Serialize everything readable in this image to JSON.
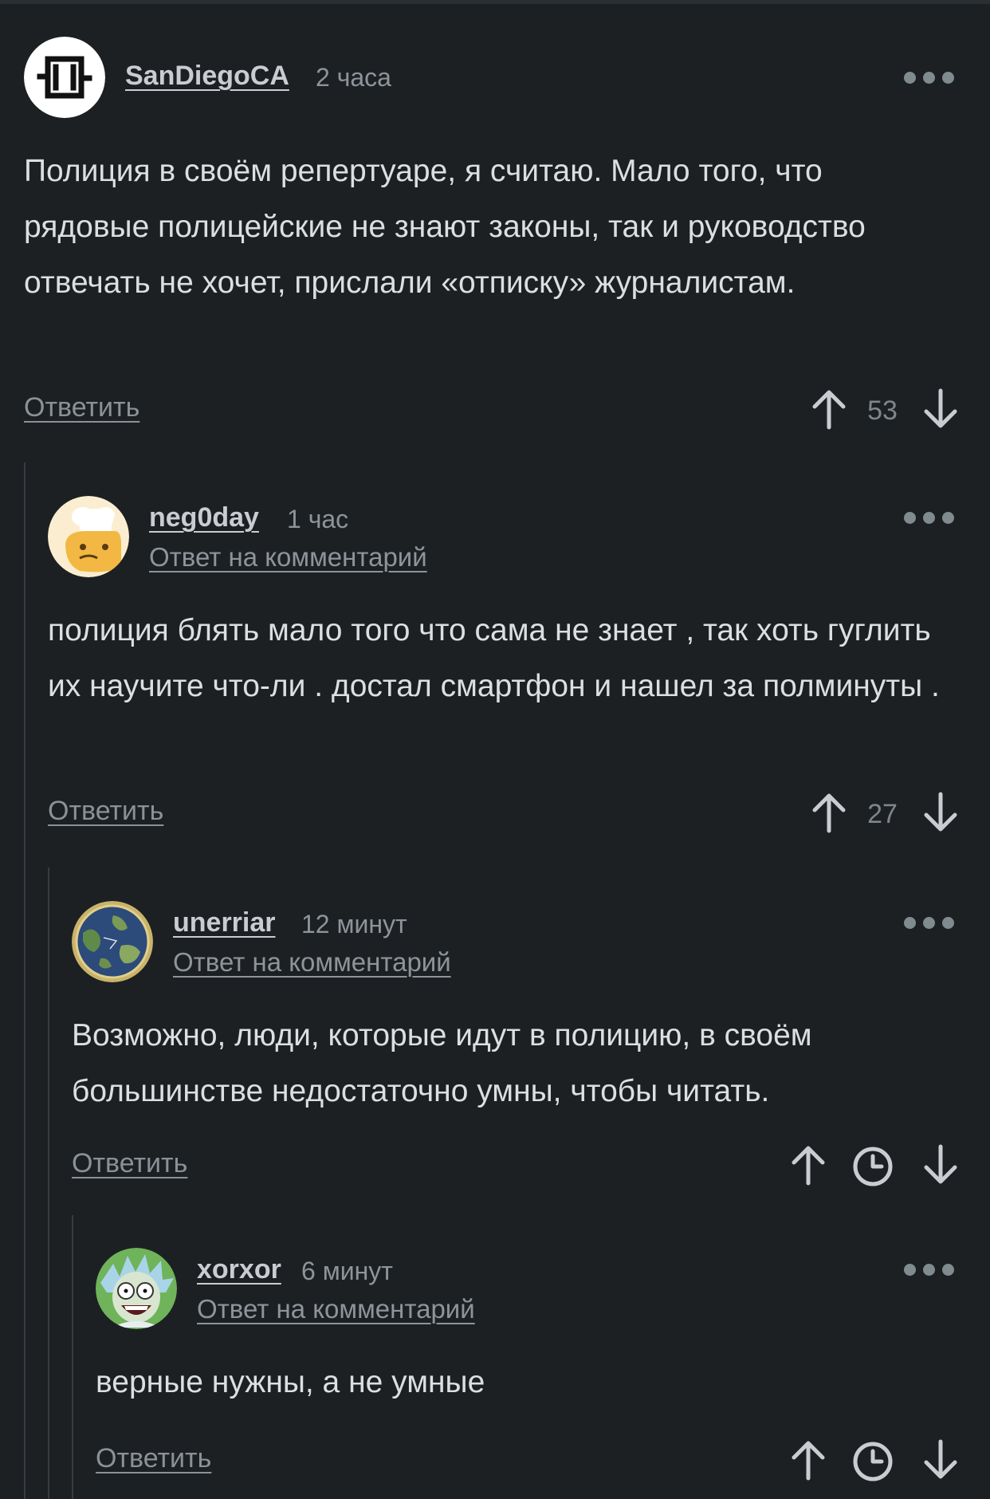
{
  "comments": [
    {
      "username": "SanDiegoCA",
      "time": "2 часа",
      "reply_to": "",
      "avatar": "rammstein-logo-icon",
      "text": "Полиция в своём репертуаре, я считаю. Мало того, что рядовые полицейские не знают законы, так и руководство отвечать не хочет, прислали «отписку» журналистам.",
      "reply_label": "Ответить",
      "rating": "53"
    },
    {
      "username": "neg0day",
      "time": "1 час",
      "reply_to": "Ответ на комментарий",
      "avatar": "chef-avatar-icon",
      "text": "полиция блять мало того что сама не знает , так хоть гуглить их научите что-ли . достал смартфон и нашел за полминуты .",
      "reply_label": "Ответить",
      "rating": "27"
    },
    {
      "username": "unerriar",
      "time": "12 минут",
      "reply_to": "Ответ на комментарий",
      "avatar": "globe-map-avatar-icon",
      "text": "Возможно, люди, которые идут в полицию, в своём большинстве недостаточно умны, чтобы читать.",
      "reply_label": "Ответить",
      "rating": "",
      "rating_pending_icon": "clock-icon"
    },
    {
      "username": "xorxor",
      "time": "6 минут",
      "reply_to": "Ответ на комментарий",
      "avatar": "cartoon-scientist-avatar-icon",
      "text": "верные нужны, а не умные",
      "reply_label": "Ответить",
      "rating": "",
      "rating_pending_icon": "clock-icon"
    }
  ],
  "colors": {
    "background": "#1c2023",
    "text": "#dcdfe2",
    "muted": "#8e949a",
    "thread_line": "#363c41",
    "menu_dots": "#7f8b8f",
    "vote_arrow": "#c9cdd1"
  },
  "icons": {
    "upvote": "arrow-up-icon",
    "downvote": "arrow-down-icon",
    "more": "more-dots-icon"
  }
}
